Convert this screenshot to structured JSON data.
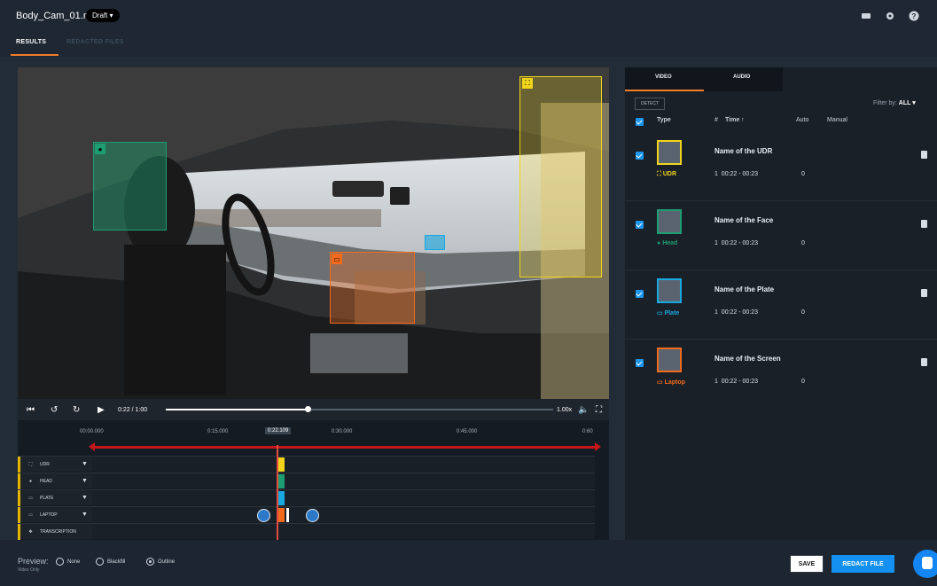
{
  "header": {
    "file_name": "Body_Cam_01.mp4",
    "status": "Draft ▾",
    "icons": [
      "keyboard-icon",
      "gear-icon",
      "help-icon"
    ]
  },
  "tabs": [
    {
      "label": "RESULTS",
      "active": true
    },
    {
      "label": "REDACTED FILES",
      "active": false
    }
  ],
  "player": {
    "current_time": "0:22",
    "separator": "/",
    "duration": "1:00",
    "speed": "1.00x",
    "progress_fraction": 0.367
  },
  "timeline": {
    "ruler_labels": [
      "00:00.000",
      "0:15.000",
      "0:30.000",
      "0:45.000",
      "0:60"
    ],
    "current_marker": "0:22.109",
    "tracks": [
      {
        "label": "UDR",
        "icon": "udr-icon",
        "color": "#f2d51b"
      },
      {
        "label": "HEAD",
        "icon": "head-icon",
        "color": "#1d9e72"
      },
      {
        "label": "PLATE",
        "icon": "plate-icon",
        "color": "#18a8e0"
      },
      {
        "label": "LAPTOP",
        "icon": "laptop-icon",
        "color": "#f26b1d"
      },
      {
        "label": "TRANSCRIPTION",
        "icon": "transcription-icon",
        "color": "#3b8fd1"
      }
    ]
  },
  "footer": {
    "preview_label": "Preview:",
    "preview_sub": "Video Only",
    "options": [
      {
        "label": "None",
        "selected": false
      },
      {
        "label": "Blackfill",
        "selected": false
      },
      {
        "label": "Outline",
        "selected": true
      }
    ],
    "save_label": "SAVE",
    "redact_label": "REDACT FILE"
  },
  "panel": {
    "tabs": [
      "VIDEO",
      "AUDIO"
    ],
    "detect_label": "DETECT",
    "filter_label": "Filter by:",
    "filter_value": "ALL ▾",
    "columns": {
      "type": "Type",
      "count": "#",
      "time": "Time ↑",
      "auto": "Auto",
      "manual": "Manual"
    },
    "rows": [
      {
        "name": "Name of the UDR",
        "type": "UDR",
        "count": "1",
        "time": "00:22 - 00:23",
        "auto": "0",
        "color": "#f2d51b"
      },
      {
        "name": "Name of the Face",
        "type": "Head",
        "count": "1",
        "time": "00:22 - 00:23",
        "auto": "0",
        "color": "#1d9e72"
      },
      {
        "name": "Name of the Plate",
        "type": "Plate",
        "count": "1",
        "time": "00:22 - 00:23",
        "auto": "0",
        "color": "#18a8e0"
      },
      {
        "name": "Name of the Screen",
        "type": "Laptop",
        "count": "1",
        "time": "00:22 - 00:23",
        "auto": "0",
        "color": "#f26b1d"
      }
    ]
  },
  "colors": {
    "accent": "#f07c2a",
    "primary_button": "#1491f0",
    "bg": "#1d2630"
  }
}
